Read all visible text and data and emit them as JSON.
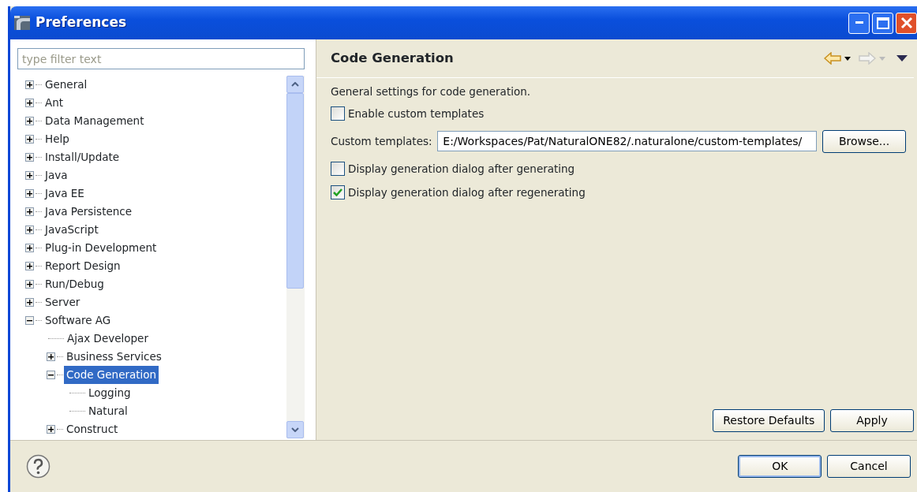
{
  "window": {
    "title": "Preferences"
  },
  "filter": {
    "placeholder": "type filter text"
  },
  "tree": [
    {
      "label": "General",
      "expanded": false,
      "selected": false
    },
    {
      "label": "Ant",
      "expanded": false,
      "selected": false
    },
    {
      "label": "Data Management",
      "expanded": false,
      "selected": false
    },
    {
      "label": "Help",
      "expanded": false,
      "selected": false
    },
    {
      "label": "Install/Update",
      "expanded": false,
      "selected": false
    },
    {
      "label": "Java",
      "expanded": false,
      "selected": false
    },
    {
      "label": "Java EE",
      "expanded": false,
      "selected": false
    },
    {
      "label": "Java Persistence",
      "expanded": false,
      "selected": false
    },
    {
      "label": "JavaScript",
      "expanded": false,
      "selected": false
    },
    {
      "label": "Plug-in Development",
      "expanded": false,
      "selected": false
    },
    {
      "label": "Report Design",
      "expanded": false,
      "selected": false
    },
    {
      "label": "Run/Debug",
      "expanded": false,
      "selected": false
    },
    {
      "label": "Server",
      "expanded": false,
      "selected": false
    },
    {
      "label": "Software AG",
      "expanded": true,
      "selected": false,
      "children": [
        {
          "label": "Ajax Developer",
          "selected": false
        },
        {
          "label": "Business Services",
          "expanded": false,
          "selected": false
        },
        {
          "label": "Code Generation",
          "expanded": true,
          "selected": true,
          "children": [
            {
              "label": "Logging",
              "selected": false
            },
            {
              "label": "Natural",
              "selected": false
            }
          ]
        },
        {
          "label": "Construct",
          "expanded": false,
          "selected": false
        }
      ]
    }
  ],
  "page": {
    "title": "Code Generation",
    "description": "General settings for code generation.",
    "options": [
      {
        "kind": "checkbox",
        "label": "Enable custom templates",
        "checked": false
      },
      {
        "kind": "path",
        "label": "Custom templates:",
        "value": "E:/Workspaces/Pat/NaturalONE82/.naturalone/custom-templates/",
        "button": "Browse..."
      },
      {
        "kind": "checkbox",
        "label": "Display generation dialog after generating",
        "checked": false
      },
      {
        "kind": "checkbox",
        "label": "Display generation dialog after regenerating",
        "checked": true
      }
    ],
    "buttons": [
      "Restore Defaults",
      "Apply"
    ]
  },
  "footer": {
    "buttons": [
      "OK",
      "Cancel"
    ]
  }
}
